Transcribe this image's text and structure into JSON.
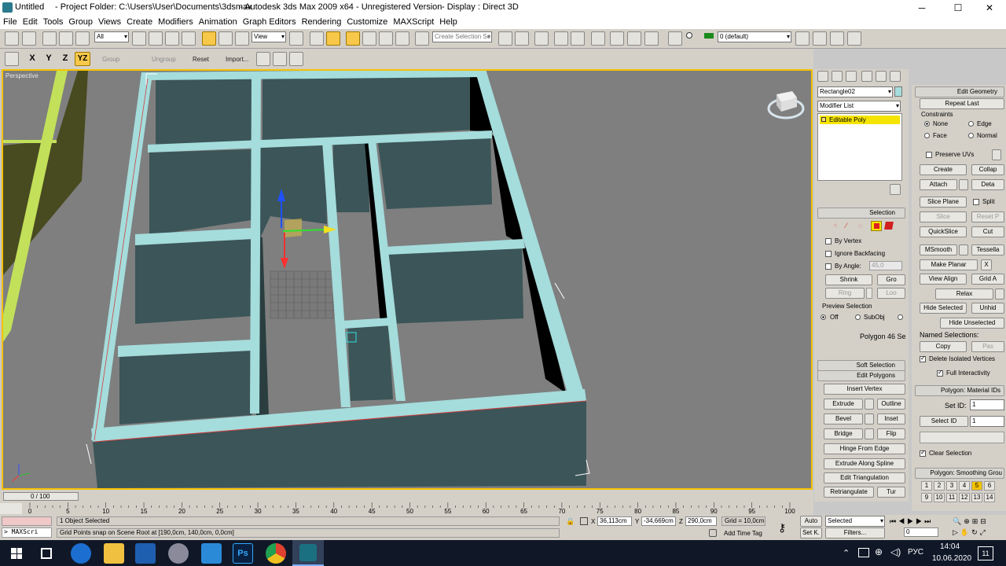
{
  "titlebar": {
    "app_name": "Untitled",
    "project_folder": "- Project Folder: C:\\Users\\User\\Documents\\3dsmax",
    "product": "- Autodesk 3ds Max  2009 x64  - Unregistered Version",
    "display": "- Display : Direct 3D",
    "minimize": "─",
    "maximize": "☐",
    "close": "✕"
  },
  "menu": [
    "File",
    "Edit",
    "Tools",
    "Group",
    "Views",
    "Create",
    "Modifiers",
    "Animation",
    "Graph Editors",
    "Rendering",
    "Customize",
    "MAXScript",
    "Help"
  ],
  "toolbar1": {
    "filter_value": "All",
    "refcoord_value": "View",
    "named_selection_placeholder": "Create Selection Se",
    "layer_value": "0 (default)"
  },
  "toolbar2": {
    "x": "X",
    "y": "Y",
    "z": "Z",
    "yz": "YZ",
    "group": "Group",
    "ungroup": "Ungroup",
    "reset": "Reset",
    "import": "Import..."
  },
  "viewport": {
    "label": "Perspective"
  },
  "command_panel": {
    "object_name": "Rectangle02",
    "modifier_list": "Modifier List",
    "stack_item": "Editable Poly",
    "selection_title": "Selection",
    "by_vertex": "By Vertex",
    "ignore_backfacing": "Ignore Backfacing",
    "by_angle": "By Angle:",
    "angle_value": "45,0",
    "shrink": "Shrink",
    "grow": "Gro",
    "ring": "Ring",
    "loop": "Loo",
    "preview_selection": "Preview Selection",
    "off": "Off",
    "subobj": "SubObj",
    "multi": "",
    "polygon_info": "Polygon 46 Se",
    "soft_selection": "Soft Selection",
    "edit_polygons": "Edit Polygons",
    "insert_vertex": "Insert Vertex",
    "extrude": "Extrude",
    "outline": "Outline",
    "bevel": "Bevel",
    "inset": "Inset",
    "bridge": "Bridge",
    "flip": "Flip",
    "hinge_from_edge": "Hinge From Edge",
    "extrude_along_spline": "Extrude Along Spline",
    "edit_triangulation": "Edit Triangulation",
    "retriangulate": "Retriangulate",
    "turn": "Tur"
  },
  "right_panel": {
    "edit_geometry": "Edit Geometry",
    "repeat_last": "Repeat Last",
    "constraints": "Constraints",
    "none": "None",
    "edge": "Edge",
    "face": "Face",
    "normal": "Normal",
    "preserve_uvs": "Preserve UVs",
    "create": "Create",
    "collapse": "Collap",
    "attach": "Attach",
    "detach": "Deta",
    "slice_plane": "Slice Plane",
    "split": "Split",
    "slice": "Slice",
    "reset_plane": "Reset P",
    "quickslice": "QuickSlice",
    "cut": "Cut",
    "msmooth": "MSmooth",
    "tessellate": "Tessella",
    "make_planar": "Make Planar",
    "x": "X",
    "view_align": "View Align",
    "grid_align": "Grid A",
    "relax": "Relax",
    "hide_selected": "Hide Selected",
    "unhide": "Unhid",
    "hide_unselected": "Hide Unselected",
    "named_selections": "Named Selections:",
    "copy": "Copy",
    "paste": "Pas",
    "delete_isolated": "Delete Isolated Vertices",
    "full_interactivity": "Full Interactivity",
    "material_ids": "Polygon: Material IDs",
    "set_id": "Set ID:",
    "set_id_value": "1",
    "select_id": "Select ID",
    "select_id_value": "1",
    "clear_selection": "Clear Selection",
    "smoothing_groups": "Polygon: Smoothing Grou",
    "sg_row1": [
      "1",
      "2",
      "3",
      "4",
      "5",
      "6"
    ],
    "sg_row2": [
      "9",
      "10",
      "11",
      "12",
      "13",
      "14"
    ],
    "sg_active": "5"
  },
  "timeline": {
    "frame": "0 / 100",
    "ticks": [
      "0",
      "5",
      "10",
      "15",
      "20",
      "25",
      "30",
      "35",
      "40",
      "45",
      "50",
      "55",
      "60",
      "65",
      "70",
      "75",
      "80",
      "85",
      "90",
      "95",
      "100"
    ]
  },
  "status": {
    "objects_selected": "1 Object Selected",
    "prompt": "Grid Points snap on Scene Root at [190,0cm, 140,0cm, 0,0cm]",
    "maxscript": "> MAXScri",
    "x_label": "X",
    "x_value": "36,113cm",
    "y_label": "Y",
    "y_value": "-34,669cm",
    "z_label": "Z",
    "z_value": "290,0cm",
    "grid": "Grid = 10,0cm",
    "add_time_tag": "Add Time Tag",
    "auto": "Auto",
    "setk": "Set K.",
    "selected": "Selected",
    "filters": "Filters...",
    "frame_value": "0"
  },
  "taskbar": {
    "language": "РУС",
    "time": "14:04",
    "date": "10.06.2020",
    "notifications": "11"
  },
  "colors": {
    "wall_dark": "#3b5558",
    "wall_top": "#a5dcdc",
    "floor": "#808080",
    "accent": "#f5c200"
  }
}
